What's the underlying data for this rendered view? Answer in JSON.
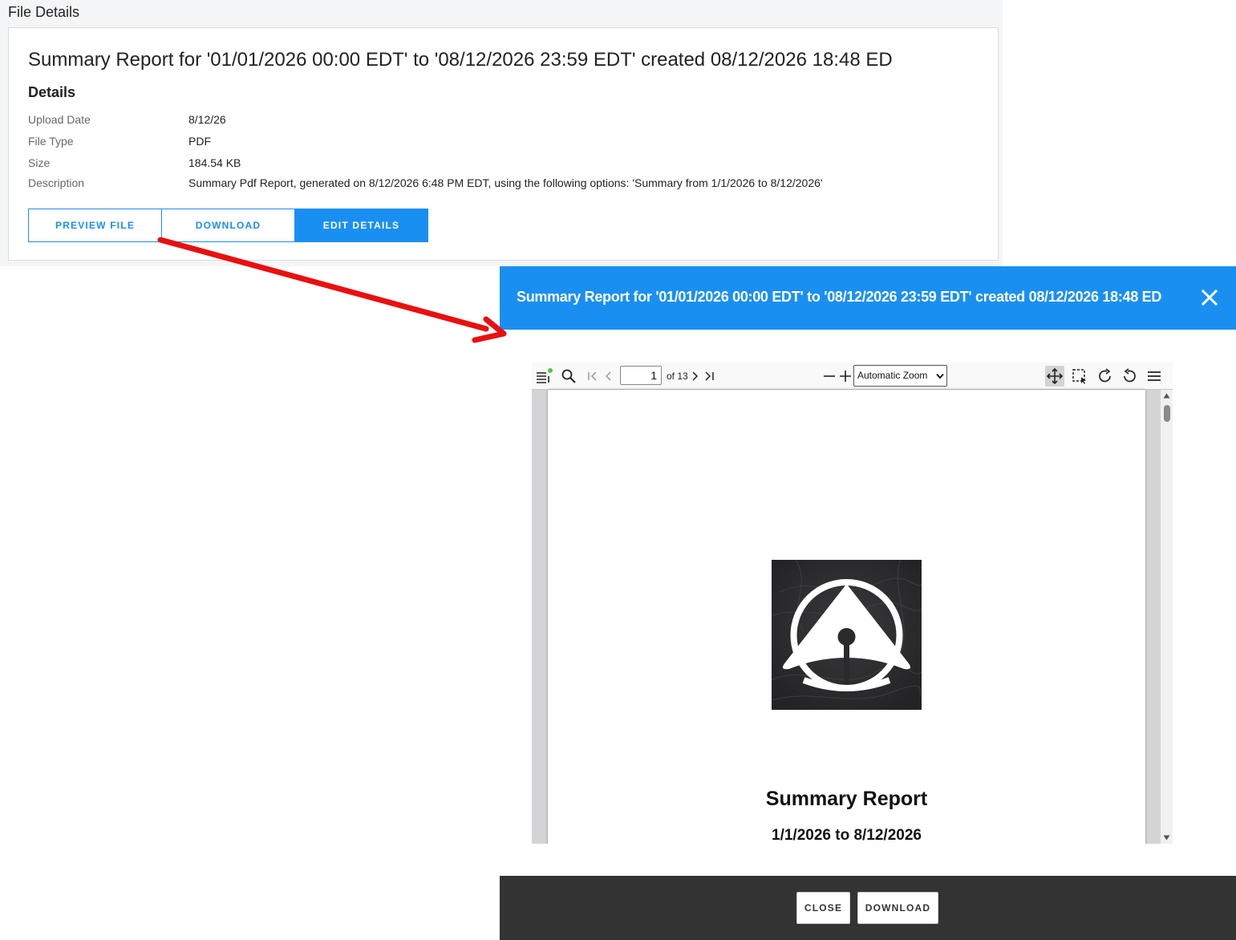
{
  "file_details": {
    "section_title": "File Details",
    "title": "Summary Report for '01/01/2026 00:00 EDT' to '08/12/2026 23:59 EDT' created 08/12/2026 18:48 ED",
    "details_heading": "Details",
    "fields": [
      {
        "label": "Upload Date",
        "value": "8/12/26"
      },
      {
        "label": "File Type",
        "value": "PDF"
      },
      {
        "label": "Size",
        "value": "184.54 KB"
      },
      {
        "label": "Description",
        "value": "Summary Pdf Report, generated on 8/12/2026 6:48 PM EDT, using the following options: 'Summary from 1/1/2026 to 8/12/2026'"
      }
    ],
    "buttons": {
      "preview": "PREVIEW FILE",
      "download": "DOWNLOAD",
      "edit": "EDIT DETAILS"
    }
  },
  "annotation": {
    "arrow_color": "#e8100f"
  },
  "modal": {
    "title": "Summary Report for '01/01/2026 00:00 EDT' to '08/12/2026 23:59 EDT' created 08/12/2026 18:48 ED",
    "close_icon": "close-icon",
    "footer": {
      "close_label": "CLOSE",
      "download_label": "DOWNLOAD"
    }
  },
  "pdf_viewer": {
    "current_page": "1",
    "page_count_text": "of 13",
    "zoom_label": "Automatic Zoom",
    "toolbar_icons": [
      "sidebar-toggle-icon",
      "find-icon",
      "first-page-icon",
      "previous-page-icon",
      "next-page-icon",
      "last-page-icon",
      "zoom-out-icon",
      "zoom-in-icon",
      "hand-tool-icon",
      "select-tool-icon",
      "rotate-clockwise-icon",
      "rotate-counterclockwise-icon",
      "tools-menu-icon"
    ],
    "document": {
      "title": "Summary Report",
      "date_range": "1/1/2026 to 8/12/2026"
    }
  },
  "colors": {
    "accent": "#1a8ff2",
    "footer_bg": "#333333",
    "logo_bg": "#2b2b2d"
  }
}
